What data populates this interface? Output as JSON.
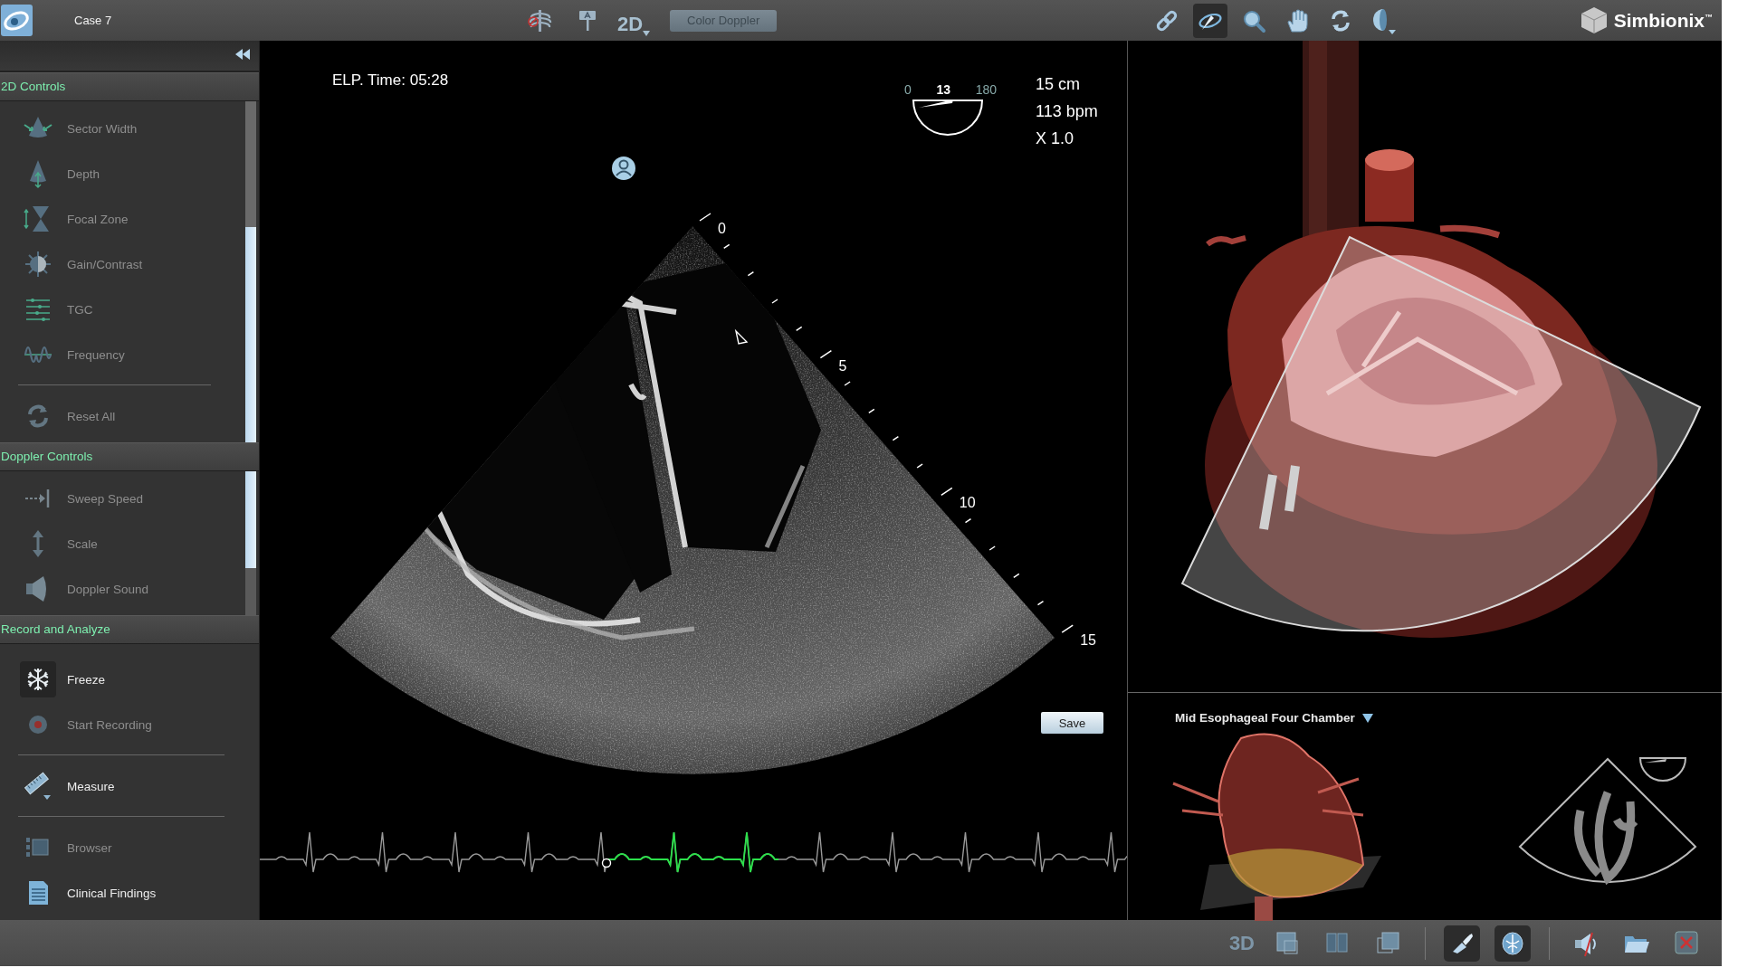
{
  "top_bar": {
    "case_title": "Case 7",
    "left_tools": [
      {
        "kind": "ribcage",
        "selected": false
      },
      {
        "kind": "pin",
        "selected": false
      }
    ],
    "mode_button": {
      "label": "2D"
    },
    "color_doppler_button": {
      "label": "Color Doppler",
      "disabled": true
    },
    "right_tools": [
      {
        "kind": "link",
        "selected": false
      },
      {
        "kind": "probe",
        "selected": true
      },
      {
        "kind": "search",
        "selected": false
      },
      {
        "kind": "hand",
        "selected": false
      },
      {
        "kind": "rotate",
        "selected": false
      },
      {
        "kind": "sphere",
        "selected": false
      }
    ],
    "brand": "Simbionix$^{™}$"
  },
  "sidebar": {
    "sections": [
      {
        "title": "2D Controls",
        "groups": [
          {
            "items": [
              {
                "kind": "sector-width",
                "label": "Sector Width",
                "disabled": true,
                "pressed": false
              },
              {
                "kind": "depth",
                "label": "Depth",
                "disabled": true,
                "pressed": false
              },
              {
                "kind": "focal-zone",
                "label": "Focal Zone",
                "disabled": true,
                "pressed": false
              },
              {
                "kind": "gain",
                "label": "Gain/Contrast",
                "disabled": true,
                "pressed": false
              },
              {
                "kind": "tgc",
                "label": "TGC",
                "disabled": true,
                "pressed": false
              },
              {
                "kind": "frequency",
                "label": "Frequency",
                "disabled": true,
                "pressed": false
              }
            ]
          },
          {
            "items": [
              {
                "kind": "reset",
                "label": "Reset All",
                "disabled": true,
                "pressed": false
              }
            ]
          }
        ]
      },
      {
        "title": "Doppler Controls",
        "groups": [
          {
            "items": [
              {
                "kind": "sweep",
                "label": "Sweep Speed",
                "disabled": true,
                "pressed": false
              },
              {
                "kind": "scale",
                "label": "Scale",
                "disabled": true,
                "pressed": false
              },
              {
                "kind": "sound",
                "label": "Doppler Sound",
                "disabled": true,
                "pressed": false
              }
            ]
          }
        ]
      },
      {
        "title": "Record and Analyze",
        "groups": [
          {
            "items": [
              {
                "kind": "freeze",
                "label": "Freeze",
                "disabled": false,
                "pressed": true
              },
              {
                "kind": "record",
                "label": "Start Recording",
                "disabled": true,
                "pressed": false
              }
            ]
          },
          {
            "items": [
              {
                "kind": "measure",
                "label": "Measure",
                "disabled": false,
                "pressed": false
              }
            ]
          },
          {
            "items": [
              {
                "kind": "browser",
                "label": "Browser",
                "disabled": true,
                "pressed": false
              },
              {
                "kind": "findings",
                "label": "Clinical Findings",
                "disabled": false,
                "pressed": false
              }
            ]
          }
        ]
      }
    ]
  },
  "ultrasound": {
    "elapsed_time": "ELP. Time: 05:28",
    "angle": {
      "min": "0",
      "value": "13",
      "max": "180"
    },
    "readouts": [
      "15 cm",
      "113 bpm",
      "X 1.0"
    ],
    "depth_marks": [
      "0",
      "5",
      "10",
      "15"
    ],
    "save_button": "Save"
  },
  "anatomy": {
    "view_label": "Mid Esophageal Four Chamber"
  },
  "bottom_bar": {
    "mode_button": {
      "label": "3D"
    },
    "layout_buttons": [
      {
        "kind": "single",
        "selected": false
      },
      {
        "kind": "split",
        "selected": false
      },
      {
        "kind": "overlay",
        "selected": false
      }
    ],
    "view_buttons": [
      {
        "kind": "probe",
        "selected": true
      },
      {
        "kind": "heart",
        "selected": true
      }
    ],
    "utility_buttons": [
      {
        "kind": "mute"
      },
      {
        "kind": "folder"
      },
      {
        "kind": "close"
      }
    ]
  }
}
